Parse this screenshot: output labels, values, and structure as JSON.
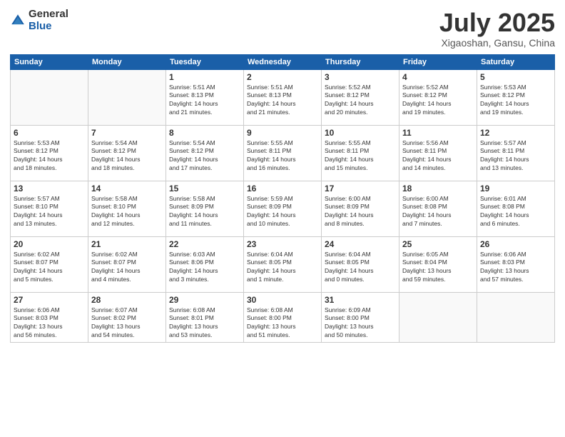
{
  "logo": {
    "general": "General",
    "blue": "Blue"
  },
  "title": "July 2025",
  "location": "Xigaoshan, Gansu, China",
  "weekdays": [
    "Sunday",
    "Monday",
    "Tuesday",
    "Wednesday",
    "Thursday",
    "Friday",
    "Saturday"
  ],
  "weeks": [
    [
      {
        "day": "",
        "info": ""
      },
      {
        "day": "",
        "info": ""
      },
      {
        "day": "1",
        "info": "Sunrise: 5:51 AM\nSunset: 8:13 PM\nDaylight: 14 hours\nand 21 minutes."
      },
      {
        "day": "2",
        "info": "Sunrise: 5:51 AM\nSunset: 8:13 PM\nDaylight: 14 hours\nand 21 minutes."
      },
      {
        "day": "3",
        "info": "Sunrise: 5:52 AM\nSunset: 8:12 PM\nDaylight: 14 hours\nand 20 minutes."
      },
      {
        "day": "4",
        "info": "Sunrise: 5:52 AM\nSunset: 8:12 PM\nDaylight: 14 hours\nand 19 minutes."
      },
      {
        "day": "5",
        "info": "Sunrise: 5:53 AM\nSunset: 8:12 PM\nDaylight: 14 hours\nand 19 minutes."
      }
    ],
    [
      {
        "day": "6",
        "info": "Sunrise: 5:53 AM\nSunset: 8:12 PM\nDaylight: 14 hours\nand 18 minutes."
      },
      {
        "day": "7",
        "info": "Sunrise: 5:54 AM\nSunset: 8:12 PM\nDaylight: 14 hours\nand 18 minutes."
      },
      {
        "day": "8",
        "info": "Sunrise: 5:54 AM\nSunset: 8:12 PM\nDaylight: 14 hours\nand 17 minutes."
      },
      {
        "day": "9",
        "info": "Sunrise: 5:55 AM\nSunset: 8:11 PM\nDaylight: 14 hours\nand 16 minutes."
      },
      {
        "day": "10",
        "info": "Sunrise: 5:55 AM\nSunset: 8:11 PM\nDaylight: 14 hours\nand 15 minutes."
      },
      {
        "day": "11",
        "info": "Sunrise: 5:56 AM\nSunset: 8:11 PM\nDaylight: 14 hours\nand 14 minutes."
      },
      {
        "day": "12",
        "info": "Sunrise: 5:57 AM\nSunset: 8:11 PM\nDaylight: 14 hours\nand 13 minutes."
      }
    ],
    [
      {
        "day": "13",
        "info": "Sunrise: 5:57 AM\nSunset: 8:10 PM\nDaylight: 14 hours\nand 13 minutes."
      },
      {
        "day": "14",
        "info": "Sunrise: 5:58 AM\nSunset: 8:10 PM\nDaylight: 14 hours\nand 12 minutes."
      },
      {
        "day": "15",
        "info": "Sunrise: 5:58 AM\nSunset: 8:09 PM\nDaylight: 14 hours\nand 11 minutes."
      },
      {
        "day": "16",
        "info": "Sunrise: 5:59 AM\nSunset: 8:09 PM\nDaylight: 14 hours\nand 10 minutes."
      },
      {
        "day": "17",
        "info": "Sunrise: 6:00 AM\nSunset: 8:09 PM\nDaylight: 14 hours\nand 8 minutes."
      },
      {
        "day": "18",
        "info": "Sunrise: 6:00 AM\nSunset: 8:08 PM\nDaylight: 14 hours\nand 7 minutes."
      },
      {
        "day": "19",
        "info": "Sunrise: 6:01 AM\nSunset: 8:08 PM\nDaylight: 14 hours\nand 6 minutes."
      }
    ],
    [
      {
        "day": "20",
        "info": "Sunrise: 6:02 AM\nSunset: 8:07 PM\nDaylight: 14 hours\nand 5 minutes."
      },
      {
        "day": "21",
        "info": "Sunrise: 6:02 AM\nSunset: 8:07 PM\nDaylight: 14 hours\nand 4 minutes."
      },
      {
        "day": "22",
        "info": "Sunrise: 6:03 AM\nSunset: 8:06 PM\nDaylight: 14 hours\nand 3 minutes."
      },
      {
        "day": "23",
        "info": "Sunrise: 6:04 AM\nSunset: 8:05 PM\nDaylight: 14 hours\nand 1 minute."
      },
      {
        "day": "24",
        "info": "Sunrise: 6:04 AM\nSunset: 8:05 PM\nDaylight: 14 hours\nand 0 minutes."
      },
      {
        "day": "25",
        "info": "Sunrise: 6:05 AM\nSunset: 8:04 PM\nDaylight: 13 hours\nand 59 minutes."
      },
      {
        "day": "26",
        "info": "Sunrise: 6:06 AM\nSunset: 8:03 PM\nDaylight: 13 hours\nand 57 minutes."
      }
    ],
    [
      {
        "day": "27",
        "info": "Sunrise: 6:06 AM\nSunset: 8:03 PM\nDaylight: 13 hours\nand 56 minutes."
      },
      {
        "day": "28",
        "info": "Sunrise: 6:07 AM\nSunset: 8:02 PM\nDaylight: 13 hours\nand 54 minutes."
      },
      {
        "day": "29",
        "info": "Sunrise: 6:08 AM\nSunset: 8:01 PM\nDaylight: 13 hours\nand 53 minutes."
      },
      {
        "day": "30",
        "info": "Sunrise: 6:08 AM\nSunset: 8:00 PM\nDaylight: 13 hours\nand 51 minutes."
      },
      {
        "day": "31",
        "info": "Sunrise: 6:09 AM\nSunset: 8:00 PM\nDaylight: 13 hours\nand 50 minutes."
      },
      {
        "day": "",
        "info": ""
      },
      {
        "day": "",
        "info": ""
      }
    ]
  ]
}
